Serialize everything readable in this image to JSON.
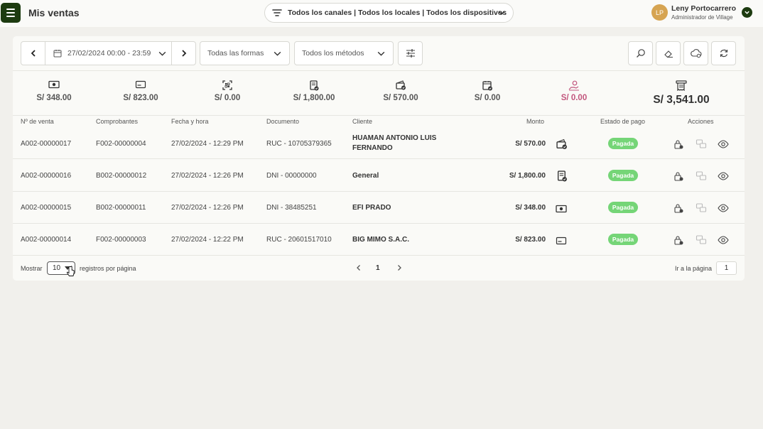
{
  "header": {
    "title": "Mis ventas",
    "channels": "Todos los canales | Todos los locales | Todos los dispositivos",
    "user_initials": "LP",
    "user_name": "Leny Portocarrero",
    "user_role": "Administrador de Village"
  },
  "filters": {
    "date_range": "27/02/2024 00:00 - 23:59",
    "forms": "Todas las formas",
    "methods": "Todos los métodos"
  },
  "stats": [
    {
      "icon": "cash-icon",
      "value": "S/ 348.00"
    },
    {
      "icon": "card-icon",
      "value": "S/ 823.00"
    },
    {
      "icon": "qr-icon",
      "value": "S/ 0.00"
    },
    {
      "icon": "transfer-doc-icon",
      "value": "S/ 1,800.00"
    },
    {
      "icon": "wallet-check-icon",
      "value": "S/ 570.00"
    },
    {
      "icon": "calendar-check-icon",
      "value": "S/ 0.00"
    },
    {
      "icon": "hand-coin-icon",
      "value": "S/ 0.00"
    },
    {
      "icon": "receipt-total-icon",
      "value": "S/ 3,541.00"
    }
  ],
  "table": {
    "headers": [
      "Nº de venta",
      "Comprobantes",
      "Fecha y hora",
      "Documento",
      "Cliente",
      "Monto",
      "Estado de pago",
      "Acciones"
    ],
    "rows": [
      {
        "sale": "A002-00000017",
        "voucher": "F002-00000004",
        "datetime": "27/02/2024 - 12:29 PM",
        "document": "RUC - 10705379365",
        "client": "HUAMAN ANTONIO LUIS FERNANDO",
        "amount": "S/ 570.00",
        "method_icon": "wallet-check-icon",
        "status": "Pagada"
      },
      {
        "sale": "A002-00000016",
        "voucher": "B002-00000012",
        "datetime": "27/02/2024 - 12:26 PM",
        "document": "DNI - 00000000",
        "client": "General",
        "amount": "S/ 1,800.00",
        "method_icon": "transfer-doc-icon",
        "status": "Pagada"
      },
      {
        "sale": "A002-00000015",
        "voucher": "B002-00000011",
        "datetime": "27/02/2024 - 12:26 PM",
        "document": "DNI - 38485251",
        "client": "EFI PRADO",
        "amount": "S/ 348.00",
        "method_icon": "cash-icon",
        "status": "Pagada"
      },
      {
        "sale": "A002-00000014",
        "voucher": "F002-00000003",
        "datetime": "27/02/2024 - 12:22 PM",
        "document": "RUC - 20601517010",
        "client": "BIG MIMO S.A.C.",
        "amount": "S/ 823.00",
        "method_icon": "card-icon",
        "status": "Pagada"
      }
    ]
  },
  "footer": {
    "show_label": "Mostrar",
    "per_page": "10",
    "per_page_suffix": "registros por página",
    "current_page": "1",
    "goto_label": "Ir a la página",
    "goto_value": "1"
  },
  "colors": {
    "brand": "#1d3b10",
    "paid_badge": "#75d577",
    "accent_pink": "#c2557d"
  }
}
